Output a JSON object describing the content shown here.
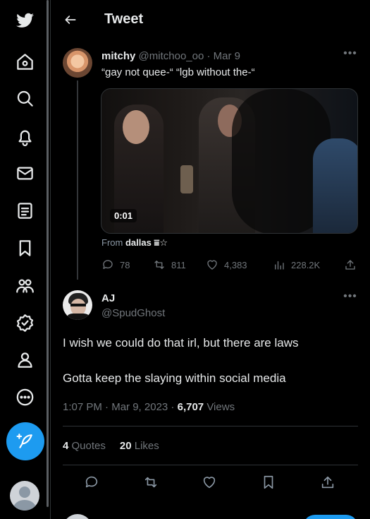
{
  "nav": {
    "items": [
      "twitter-logo",
      "home",
      "explore",
      "notifications",
      "messages",
      "lists",
      "bookmarks",
      "communities",
      "verified",
      "profile",
      "more"
    ]
  },
  "header": {
    "title": "Tweet"
  },
  "parent_tweet": {
    "name": "mitchy",
    "handle": "@mitchoo_oo",
    "sep": " · ",
    "date": "Mar 9",
    "text": "“gay not quee-“ “lgb without the-“",
    "video_time": "0:01",
    "from_label": "From",
    "from_source": "dallas ⩸☆",
    "replies": "78",
    "retweets": "811",
    "likes": "4,383",
    "views": "228.2K"
  },
  "main_tweet": {
    "name": "AJ",
    "handle": "@SpudGhost",
    "line1": "I wish we could do that irl, but there are laws",
    "line2": "Gotta keep the slaying within social media",
    "time": "1:07 PM",
    "date": "Mar 9, 2023",
    "views_count": "6,707",
    "views_label": "Views",
    "quotes_count": "4",
    "quotes_label": "Quotes",
    "likes_count": "20",
    "likes_label": "Likes"
  },
  "colors": {
    "accent": "#1d9bf0",
    "bg": "#000000",
    "muted": "#71767b"
  }
}
